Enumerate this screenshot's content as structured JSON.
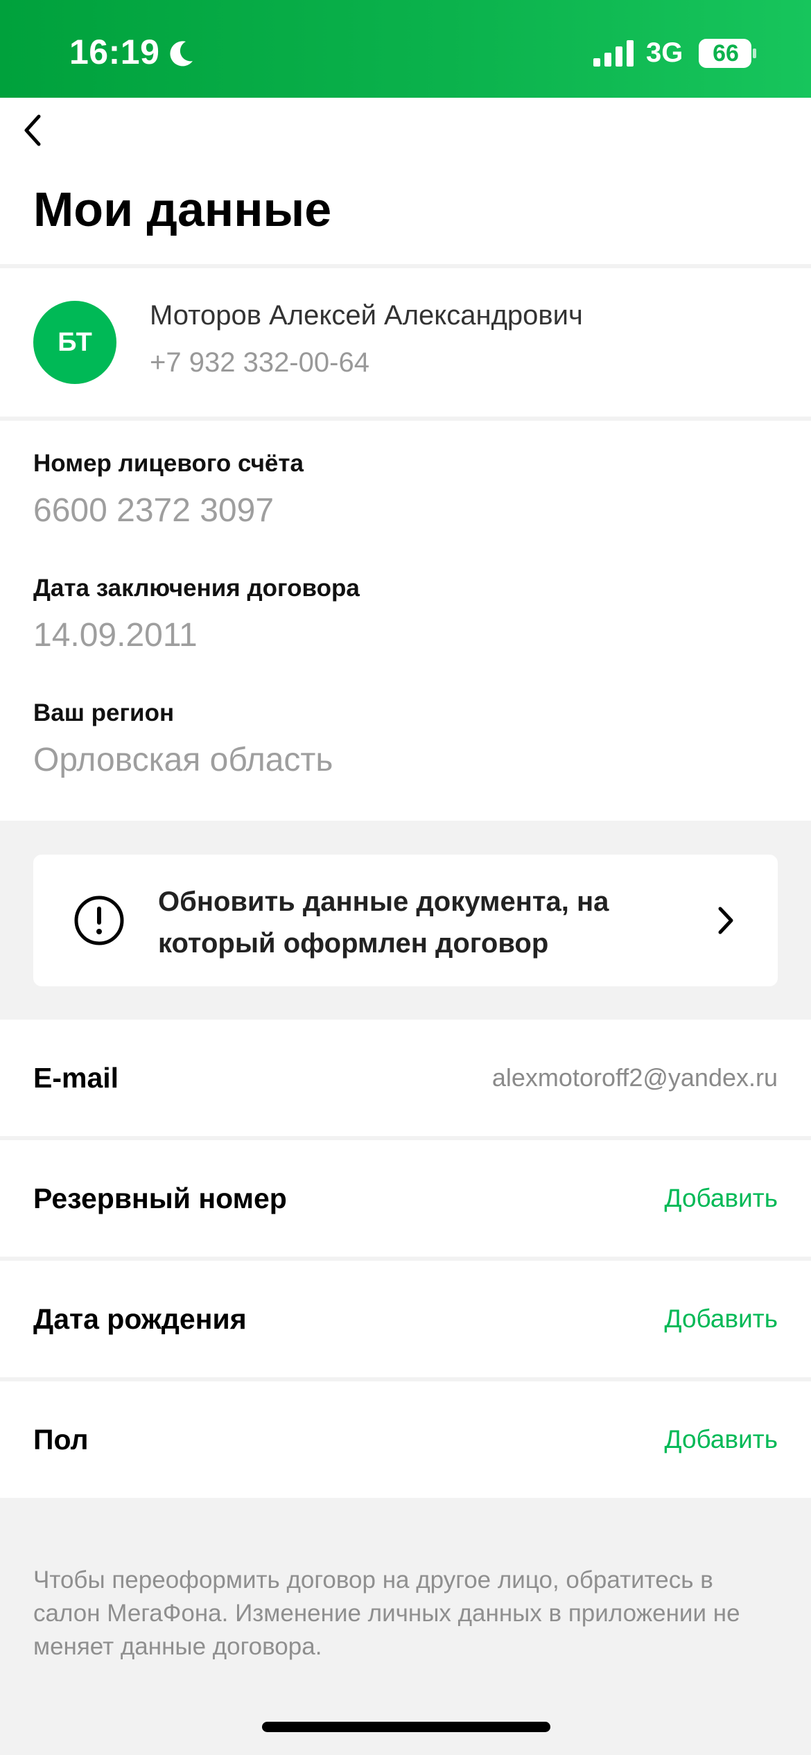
{
  "status_bar": {
    "time": "16:19",
    "network": "3G",
    "battery": "66",
    "icons": [
      "moon-icon",
      "signal-icon",
      "battery-icon"
    ],
    "background": "#0bb24c"
  },
  "header": {
    "title": "Мои данные",
    "back_icon": "chevron-left-icon"
  },
  "profile": {
    "initials": "БТ",
    "name": "Моторов Алексей Александрович",
    "phone": "+7 932 332-00-64",
    "avatar_color": "#00b956"
  },
  "info": [
    {
      "label": "Номер лицевого счёта",
      "value": "6600 2372 3097"
    },
    {
      "label": "Дата заключения договора",
      "value": "14.09.2011"
    },
    {
      "label": "Ваш регион",
      "value": "Орловская область"
    }
  ],
  "notice": {
    "text": "Обновить данные документа, на который оформлен договор",
    "icon": "alert-circle-icon"
  },
  "rows": [
    {
      "label": "E-mail",
      "value": "alexmotoroff2@yandex.ru"
    },
    {
      "label": "Резервный номер",
      "action": "Добавить"
    },
    {
      "label": "Дата рождения",
      "action": "Добавить"
    },
    {
      "label": "Пол",
      "action": "Добавить"
    }
  ],
  "footnote": "Чтобы переоформить договор на другое лицо, обратитесь в салон МегаФона. Изменение личных данных в приложении не меняет данные договора.",
  "colors": {
    "accent": "#00b956",
    "background": "#f2f2f2"
  }
}
